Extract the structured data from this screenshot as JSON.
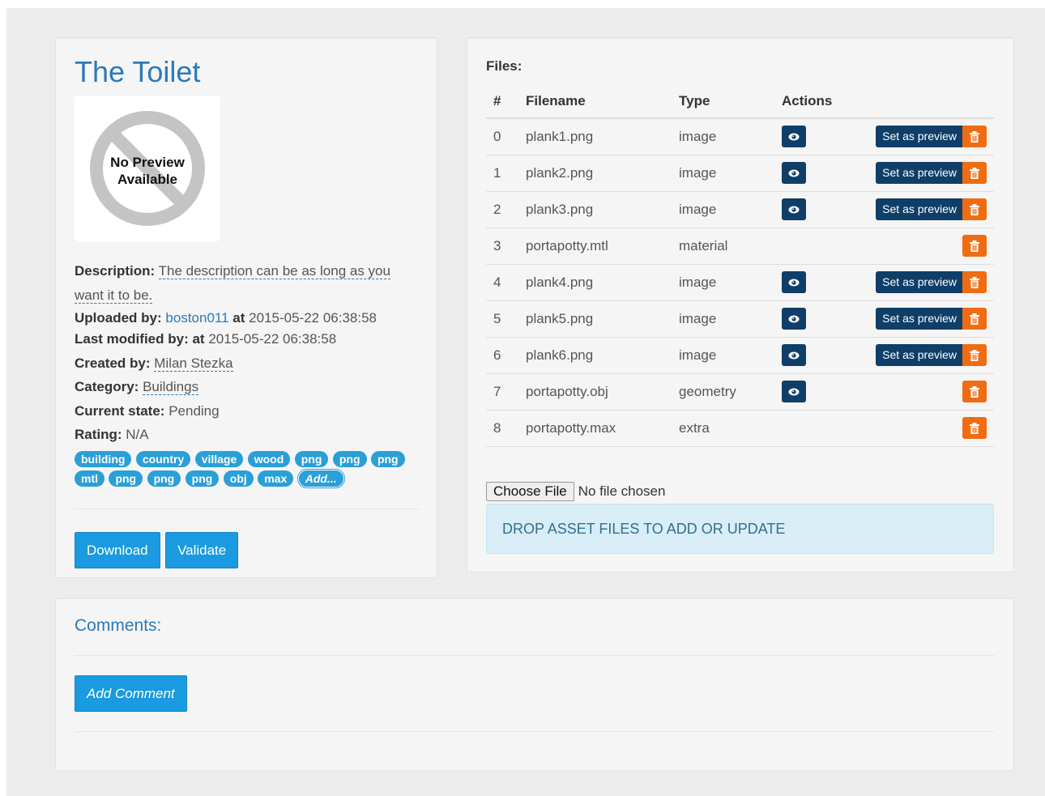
{
  "asset": {
    "title": "The Toilet",
    "preview_text_line1": "No Preview",
    "preview_text_line2": "Available",
    "description_label": "Description:",
    "description_value": "The description can be as long as you want it to be.",
    "uploaded_by_label": "Uploaded by:",
    "uploaded_by_user": "boston011",
    "uploaded_at_label": "at",
    "uploaded_at": "2015-05-22 06:38:58",
    "last_modified_label": "Last modified by:",
    "last_modified_at_label": "at",
    "last_modified_at": "2015-05-22 06:38:58",
    "created_by_label": "Created by:",
    "created_by_value": "Milan Stezka",
    "category_label": "Category:",
    "category_value": "Buildings",
    "state_label": "Current state:",
    "state_value": "Pending",
    "rating_label": "Rating:",
    "rating_value": "N/A",
    "tags": [
      "building",
      "country",
      "village",
      "wood",
      "png",
      "png",
      "png",
      "mtl",
      "png",
      "png",
      "png",
      "obj",
      "max"
    ],
    "add_tag_label": "Add...",
    "download_label": "Download",
    "validate_label": "Validate"
  },
  "files": {
    "label": "Files:",
    "columns": [
      "#",
      "Filename",
      "Type",
      "Actions"
    ],
    "rows": [
      {
        "num": "0",
        "filename": "plank1.png",
        "type": "image",
        "view": true,
        "set_preview": true
      },
      {
        "num": "1",
        "filename": "plank2.png",
        "type": "image",
        "view": true,
        "set_preview": true
      },
      {
        "num": "2",
        "filename": "plank3.png",
        "type": "image",
        "view": true,
        "set_preview": true
      },
      {
        "num": "3",
        "filename": "portapotty.mtl",
        "type": "material",
        "view": false,
        "set_preview": false
      },
      {
        "num": "4",
        "filename": "plank4.png",
        "type": "image",
        "view": true,
        "set_preview": true
      },
      {
        "num": "5",
        "filename": "plank5.png",
        "type": "image",
        "view": true,
        "set_preview": true
      },
      {
        "num": "6",
        "filename": "plank6.png",
        "type": "image",
        "view": true,
        "set_preview": true
      },
      {
        "num": "7",
        "filename": "portapotty.obj",
        "type": "geometry",
        "view": true,
        "set_preview": false
      },
      {
        "num": "8",
        "filename": "portapotty.max",
        "type": "extra",
        "view": false,
        "set_preview": false
      }
    ],
    "set_preview_label": "Set as preview",
    "choose_file_label": "Choose File",
    "no_file_label": "No file chosen",
    "dropzone_label": "DROP ASSET FILES TO ADD OR UPDATE"
  },
  "comments": {
    "title": "Comments:",
    "add_comment_label": "Add Comment"
  },
  "icons": {
    "view": "eye-icon",
    "delete": "trash-icon",
    "preview_placeholder": "no-symbol-icon"
  },
  "colors": {
    "accent": "#2a7ab9",
    "button_blue": "#1a9ae0",
    "navy": "#0f3e68",
    "orange": "#ef6c12",
    "info_bg": "#d9edf7"
  }
}
